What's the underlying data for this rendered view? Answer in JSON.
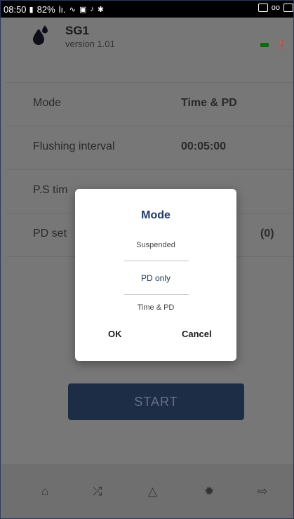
{
  "status_bar": {
    "time": "08:50",
    "battery": "82%",
    "extra": "lı.",
    "icons": [
      "battery-icon",
      "signal-icon",
      "hotspot-icon",
      "photo-icon",
      "mute-icon",
      "bluetooth-icon",
      "app-icon",
      "voicemail-icon",
      "calendar-icon"
    ]
  },
  "header": {
    "device_name": "SG1",
    "version": "version 1.01"
  },
  "rows": [
    {
      "label": "Mode",
      "value": "Time & PD"
    },
    {
      "label": "Flushing interval",
      "value": "00:05:00"
    },
    {
      "label": "P.S tim",
      "value": ""
    },
    {
      "label": "PD set",
      "value": "(0)"
    }
  ],
  "start_button": {
    "label": "START"
  },
  "bottom_nav": {
    "items": [
      "home-icon",
      "wrench-icon",
      "flask-icon",
      "gear-icon",
      "logout-icon"
    ]
  },
  "dialog": {
    "title": "Mode",
    "options": [
      "Suspended",
      "PD only",
      "Time & PD"
    ],
    "selected": "PD only",
    "ok_label": "OK",
    "cancel_label": "Cancel"
  }
}
